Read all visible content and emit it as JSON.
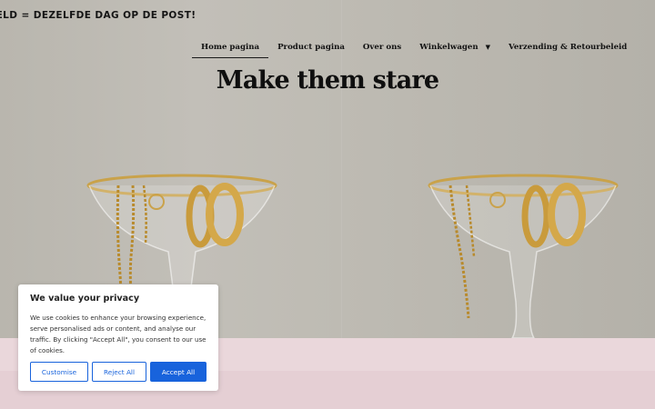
{
  "announcement": {
    "text": "'ELD = DEZELFDE DAG OP DE POST!"
  },
  "nav": {
    "items": [
      {
        "label": "Home pagina",
        "active": true
      },
      {
        "label": "Product pagina"
      },
      {
        "label": "Over ons"
      },
      {
        "label": "Winkelwagen",
        "dropdown": true
      },
      {
        "label": "Verzending & Retourbeleid"
      }
    ]
  },
  "hero": {
    "title": "Make them stare"
  },
  "cookie": {
    "title": "We value your privacy",
    "text": "We use cookies to enhance your browsing experience, serve personalised ads or content, and analyse our traffic. By clicking \"Accept All\", you consent to our use of cookies.",
    "customise_label": "Customise",
    "reject_label": "Reject All",
    "accept_label": "Accept All",
    "accent_color": "#1863dc"
  },
  "colors": {
    "hero_background": "#bdbab2",
    "page_background": "#ead7db"
  }
}
